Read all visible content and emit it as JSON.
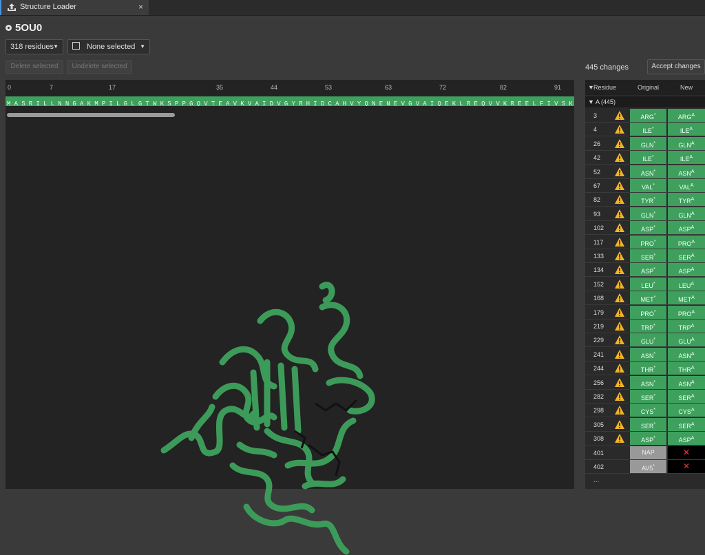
{
  "tab": {
    "title": "Structure Loader",
    "close": "×"
  },
  "structure": {
    "id": "5OU0"
  },
  "toolbar": {
    "residues_dropdown": "318 residues",
    "selection_dropdown": "None selected",
    "delete_button": "Delete selected",
    "undelete_button": "Undelete selected"
  },
  "changes": {
    "count_label": "445 changes",
    "accept_button": "Accept changes"
  },
  "ruler_ticks": [
    "0",
    "7",
    "17",
    "35",
    "44",
    "53",
    "63",
    "72",
    "82",
    "91"
  ],
  "sequence": "M A S R I L L N N G A K M P I L G L G T W K S P P G Q V T E A V K V A I D V G Y R H I D C A H V Y Q N E N E V G V A I Q E K L R E Q V V K R E E L F I V S K L W C T Y H E K G L V K G A C Q",
  "table": {
    "headers": {
      "residue": "Residue",
      "original": "Original",
      "new": "New"
    },
    "chain_label": "A (445)",
    "rows": [
      {
        "num": "3",
        "orig": "ARG",
        "new": "ARG"
      },
      {
        "num": "4",
        "orig": "ILE",
        "new": "ILE"
      },
      {
        "num": "26",
        "orig": "GLN",
        "new": "GLN"
      },
      {
        "num": "42",
        "orig": "ILE",
        "new": "ILE"
      },
      {
        "num": "52",
        "orig": "ASN",
        "new": "ASN"
      },
      {
        "num": "67",
        "orig": "VAL",
        "new": "VAL"
      },
      {
        "num": "82",
        "orig": "TYR",
        "new": "TYR"
      },
      {
        "num": "93",
        "orig": "GLN",
        "new": "GLN"
      },
      {
        "num": "102",
        "orig": "ASP",
        "new": "ASP"
      },
      {
        "num": "117",
        "orig": "PRO",
        "new": "PRO"
      },
      {
        "num": "133",
        "orig": "SER",
        "new": "SER"
      },
      {
        "num": "134",
        "orig": "ASP",
        "new": "ASP"
      },
      {
        "num": "152",
        "orig": "LEU",
        "new": "LEU"
      },
      {
        "num": "168",
        "orig": "MET",
        "new": "MET"
      },
      {
        "num": "179",
        "orig": "PRO",
        "new": "PRO"
      },
      {
        "num": "219",
        "orig": "TRP",
        "new": "TRP"
      },
      {
        "num": "229",
        "orig": "GLU",
        "new": "GLU"
      },
      {
        "num": "241",
        "orig": "ASN",
        "new": "ASN"
      },
      {
        "num": "244",
        "orig": "THR",
        "new": "THR"
      },
      {
        "num": "256",
        "orig": "ASN",
        "new": "ASN"
      },
      {
        "num": "282",
        "orig": "SER",
        "new": "SER"
      },
      {
        "num": "298",
        "orig": "CYS",
        "new": "CYS"
      },
      {
        "num": "305",
        "orig": "SER",
        "new": "SER"
      },
      {
        "num": "308",
        "orig": "ASP",
        "new": "ASP"
      }
    ],
    "ligand_rows": [
      {
        "num": "401",
        "orig": "NAP"
      },
      {
        "num": "402",
        "orig": "AV5"
      }
    ],
    "orig_marker": "*",
    "new_marker": "A",
    "remove_glyph": "✕",
    "more": "..."
  },
  "colors": {
    "accent_green": "#3fa05e",
    "warning": "#f0b429",
    "remove": "#e33333"
  }
}
